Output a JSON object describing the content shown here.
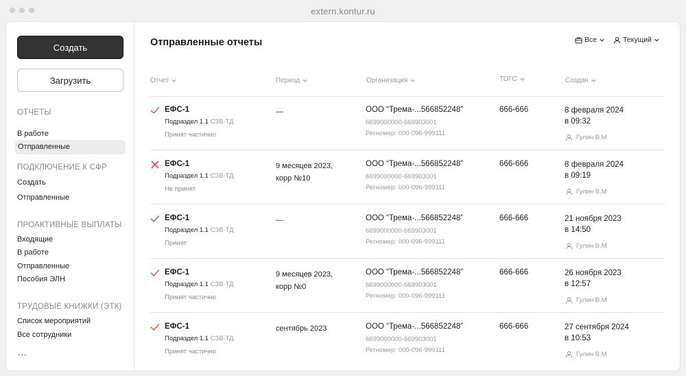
{
  "browser": {
    "url": "extern.kontur.ru"
  },
  "sidebar": {
    "create_label": "Создать",
    "upload_label": "Загрузить",
    "sections": [
      {
        "title": "ОТЧЕТЫ",
        "items": [
          "В работе",
          "Отправленные"
        ]
      },
      {
        "title": "ПОДКЛЮЧЕНИЕ К СФР",
        "items": [
          "Создать",
          "Отправленные"
        ]
      },
      {
        "title": "ПРОАКТИВНЫЕ ВЫПЛАТЫ",
        "items": [
          "Входящие",
          "В работе",
          "Отправленные",
          "Пособия ЭЛН"
        ]
      },
      {
        "title": "ТРУДОВЫЕ КНИЖКИ (ЭТК)",
        "items": [
          "Список мероприятий",
          "Все сотрудники"
        ]
      }
    ],
    "more_label": "..."
  },
  "main": {
    "title": "Отправленные отчеты",
    "filters": {
      "all_label": "Все",
      "current_label": "Текущий"
    },
    "columns": [
      "Отчет",
      "Период",
      "Организация",
      "ТОГС",
      "Создан"
    ],
    "rows": [
      {
        "status_icon": "check-icon",
        "status_color": "#e8623a",
        "title": "ЕФС-1",
        "sub": "Подраздел 1.1",
        "sub_muted": "СЗВ-ТД",
        "status": "Принят частично",
        "period": "—",
        "org": "ООО “Трема-...566852248”",
        "inn": "6699000000-669903001",
        "reg": "Регномер: 000-096-999111",
        "togs": "666-666",
        "date": "8 февраля 2024",
        "time": "в 09:32",
        "user": "Гулин В.М"
      },
      {
        "status_icon": "cross-icon",
        "status_color": "#e0433a",
        "title": "ЕФС-1",
        "sub": "Подраздел 1.1",
        "sub_muted": "СЗВ-ТД",
        "status": "Не принят",
        "period": "9 месяцев 2023,",
        "period2": "корр №10",
        "org": "ООО “Трема-...566852248”",
        "inn": "6699000000-669903001",
        "reg": "Регномер: 000-096-999111",
        "togs": "666-666",
        "date": "8 февраля 2024",
        "time": "в 09:19",
        "user": "Гулин В.М"
      },
      {
        "status_icon": "check-icon",
        "status_color": "#3aa64a",
        "title": "ЕФС-1",
        "sub": "Подраздел 1.1",
        "sub_muted": "СЗВ-ТД",
        "status": "Принят",
        "period": "—",
        "org": "ООО “Трема-...566852248”",
        "inn": "6699000000-669903001",
        "reg": "Регномер: 000-096-999111",
        "togs": "666-666",
        "date": "21 ноября 2023",
        "time": "в 14:50",
        "user": "Гулин В.М"
      },
      {
        "status_icon": "check-icon",
        "status_color": "#e8623a",
        "title": "ЕФС-1",
        "sub": "Подраздел 1.1",
        "sub_muted": "СЗВ-ТД",
        "status": "Принят частично",
        "period": "9 месяцев 2023,",
        "period2": "корр №0",
        "org": "ООО “Трема-...566852248”",
        "inn": "6699000000-669903001",
        "reg": "Регномер: 000-096-999111",
        "togs": "666-666",
        "date": "26 ноября 2023",
        "time": "в 12:57",
        "user": "Гулин В.М"
      },
      {
        "status_icon": "check-icon",
        "status_color": "#e8623a",
        "title": "ЕФС-1",
        "sub": "Подраздел 1.1",
        "sub_muted": "СЗВ-ТД",
        "status": "Принят частично",
        "period": "сентябрь 2023",
        "org": "ООО “Трема-...566852248”",
        "inn": "6699000000-669903001",
        "reg": "Регномер: 000-096-999111",
        "togs": "666-666",
        "date": "27 сентября 2024",
        "time": "в 10:53",
        "user": "Гулин В.М"
      }
    ]
  }
}
